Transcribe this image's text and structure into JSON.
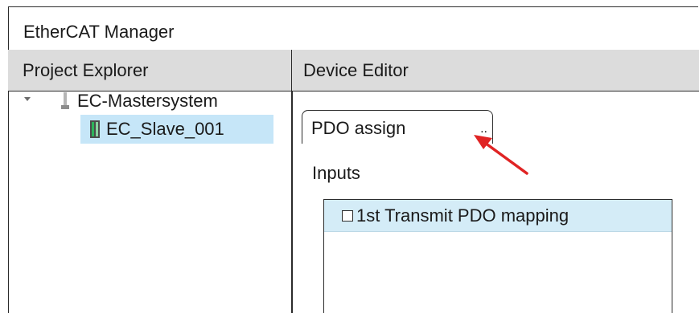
{
  "window": {
    "title": "EtherCAT Manager"
  },
  "project_explorer": {
    "header": "Project Explorer",
    "tree": {
      "master": {
        "label": "EC-Mastersystem",
        "expanded": true,
        "icon": "master-system-icon"
      },
      "slave": {
        "label": "EC_Slave_001",
        "selected": true,
        "icon": "slave-device-icon"
      }
    }
  },
  "device_editor": {
    "header": "Device Editor",
    "tab": {
      "label": "PDO assign",
      "dots": ".."
    },
    "inputs_label": "Inputs",
    "pdo_list": [
      {
        "label": "1st Transmit PDO mapping",
        "checked": false
      }
    ]
  },
  "colors": {
    "selection": "#c6e6f8",
    "row_highlight": "#d4ecf7",
    "header_bg": "#dcdcdc",
    "annotation_arrow": "#e02424"
  }
}
